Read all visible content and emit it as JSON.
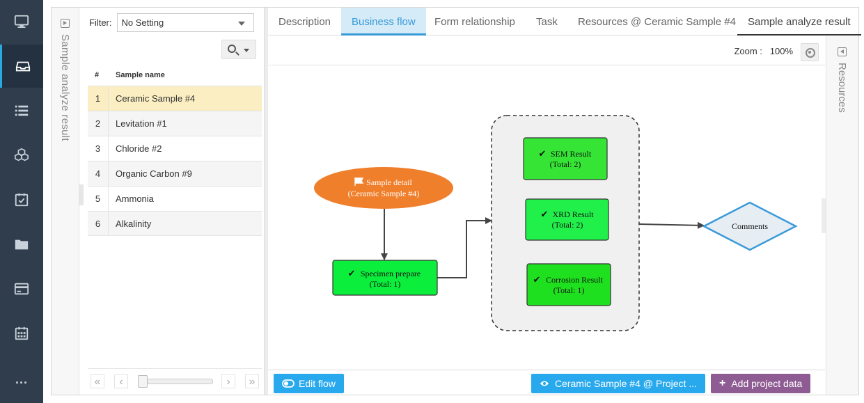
{
  "nav": {
    "items": [
      {
        "icon": "monitor-icon"
      },
      {
        "icon": "inbox-icon",
        "active": true
      },
      {
        "icon": "list-icon"
      },
      {
        "icon": "cubes-icon"
      },
      {
        "icon": "calendar-check-icon"
      },
      {
        "icon": "folder-icon"
      },
      {
        "icon": "credit-card-icon"
      },
      {
        "icon": "calendar-icon"
      },
      {
        "icon": "more-icon",
        "label": "..."
      }
    ]
  },
  "left_panel": {
    "title": "Sample analyze result"
  },
  "filter": {
    "label": "Filter:",
    "value": "No Setting"
  },
  "grid": {
    "headers": {
      "num": "#",
      "name": "Sample name"
    },
    "rows": [
      {
        "num": "1",
        "name": "Ceramic Sample #4",
        "selected": true
      },
      {
        "num": "2",
        "name": "Levitation #1"
      },
      {
        "num": "3",
        "name": "Chloride #2"
      },
      {
        "num": "4",
        "name": "Organic Carbon #9"
      },
      {
        "num": "5",
        "name": "Ammonia"
      },
      {
        "num": "6",
        "name": "Alkalinity"
      }
    ]
  },
  "tabs": [
    {
      "label": "Description"
    },
    {
      "label": "Business flow",
      "active": true
    },
    {
      "label": "Form relationship"
    },
    {
      "label": "Task"
    },
    {
      "label": "Resources @ Ceramic Sample #4"
    },
    {
      "label": "Sample analyze result"
    }
  ],
  "zoom": {
    "label": "Zoom :",
    "value": "100%"
  },
  "right_panel": {
    "title": "Resources"
  },
  "flow": {
    "start": {
      "line1": "Sample detail",
      "line2": "(Ceramic Sample #4)",
      "color": "#f07f2b"
    },
    "specimen": {
      "line1": "Specimen prepare",
      "line2": "(Total: 1)"
    },
    "sem": {
      "line1": "SEM Result",
      "line2": "(Total: 2)"
    },
    "xrd": {
      "line1": "XRD Result",
      "line2": "(Total: 2)"
    },
    "corrosion": {
      "line1": "Corrosion Result",
      "line2": "(Total: 1)"
    },
    "comments": {
      "label": "Comments"
    },
    "node_color": "#0cee3c",
    "diamond_border": "#3a9ad9"
  },
  "buttons": {
    "edit_flow": "Edit flow",
    "view_project": "Ceramic Sample #4 @ Project ...",
    "add_project_data": "Add project data"
  },
  "colors": {
    "accent": "#29a9ed",
    "purple": "#8e5b93",
    "nav_bg": "#2f3d4c",
    "selected_row": "#fbeec2"
  }
}
